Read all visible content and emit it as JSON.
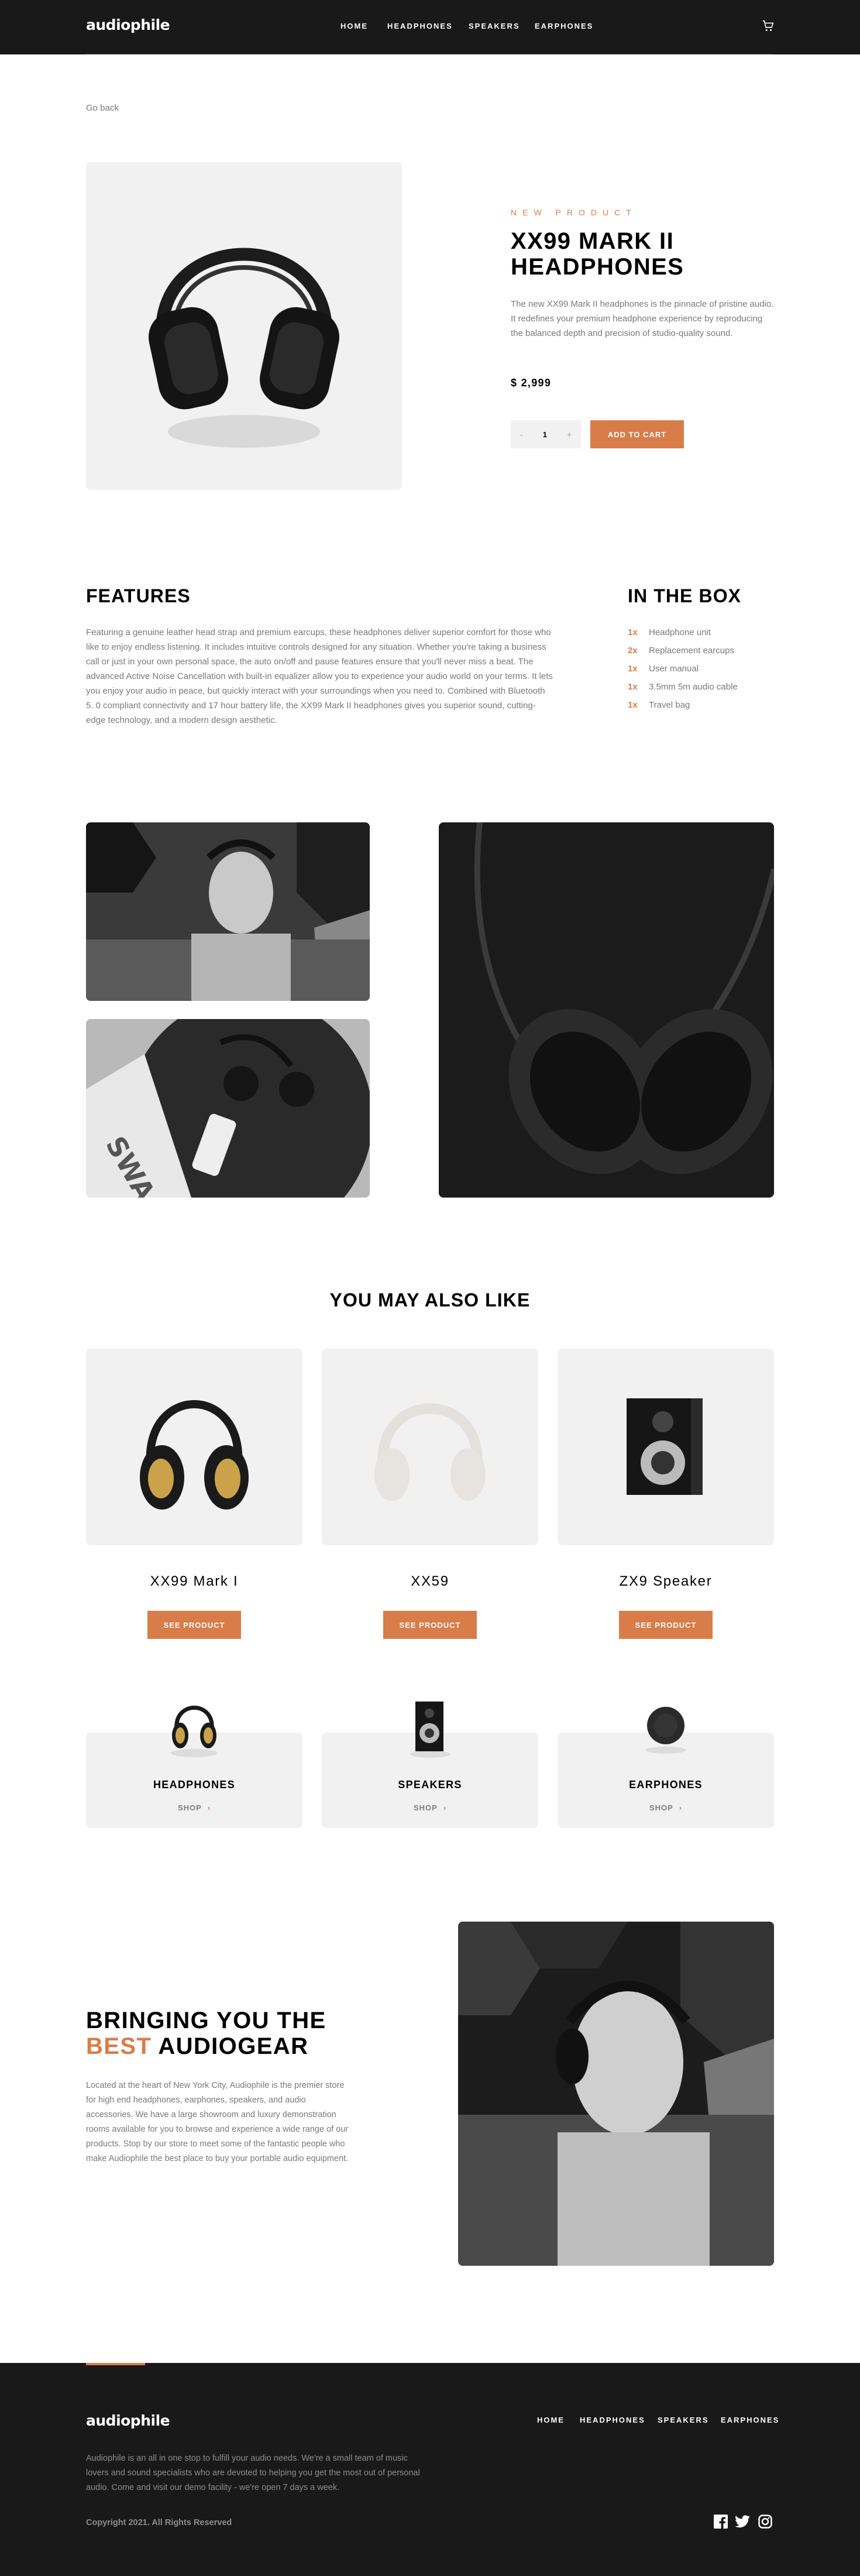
{
  "header": {
    "logo": "audiophile",
    "nav": [
      "HOME",
      "HEADPHONES",
      "SPEAKERS",
      "EARPHONES"
    ],
    "cart_icon": "cart-icon"
  },
  "go_back": "Go back",
  "product": {
    "badge": "NEW PRODUCT",
    "title_line1": "XX99 MARK II",
    "title_line2": "HEADPHONES",
    "description": "The new XX99 Mark II headphones is the pinnacle of pristine audio. It redefines your premium headphone experience by reproducing the balanced depth and precision of studio-quality sound.",
    "price": "$ 2,999",
    "quantity": {
      "minus": "-",
      "value": "1",
      "plus": "+"
    },
    "add_to_cart": "ADD TO CART"
  },
  "features": {
    "heading": "FEATURES",
    "text": "Featuring a genuine leather head strap and premium earcups, these headphones deliver superior comfort for those who like to enjoy endless listening. It includes intuitive controls designed for any situation. Whether you're taking a business call or just in your own personal space, the auto on/off and pause features ensure that you'll never miss a beat. The advanced Active Noise Cancellation with built-in equalizer allow you to experience your audio world on your terms. It lets you enjoy your audio in peace, but quickly interact with your surroundings when you need to. Combined with Bluetooth 5. 0 compliant connectivity and 17 hour battery life, the XX99 Mark II headphones gives you superior sound, cutting-edge technology, and a modern design aesthetic."
  },
  "in_the_box": {
    "heading": "IN THE BOX",
    "items": [
      {
        "qty": "1x",
        "name": "Headphone unit"
      },
      {
        "qty": "2x",
        "name": "Replacement earcups"
      },
      {
        "qty": "1x",
        "name": "User manual"
      },
      {
        "qty": "1x",
        "name": "3.5mm 5m audio cable"
      },
      {
        "qty": "1x",
        "name": "Travel bag"
      }
    ]
  },
  "also_like": {
    "heading": "YOU MAY ALSO LIKE",
    "items": [
      {
        "name": "XX99 Mark I",
        "button": "SEE PRODUCT"
      },
      {
        "name": "XX59",
        "button": "SEE PRODUCT"
      },
      {
        "name": "ZX9 Speaker",
        "button": "SEE PRODUCT"
      }
    ]
  },
  "categories": [
    {
      "name": "HEADPHONES",
      "shop": "SHOP"
    },
    {
      "name": "SPEAKERS",
      "shop": "SHOP"
    },
    {
      "name": "EARPHONES",
      "shop": "SHOP"
    }
  ],
  "about": {
    "heading_line1": "BRINGING YOU THE",
    "heading_accent": "BEST",
    "heading_rest": "AUDIOGEAR",
    "text": "Located at the heart of New York City, Audiophile is the premier store for high end headphones, earphones, speakers, and audio accessories. We have a large showroom and luxury demonstration rooms available for you to browse and experience a wide range of our products. Stop by our store to meet some of the fantastic people who make Audiophile the best place to buy your portable audio equipment."
  },
  "footer": {
    "logo": "audiophile",
    "nav": [
      "HOME",
      "HEADPHONES",
      "SPEAKERS",
      "EARPHONES"
    ],
    "text": "Audiophile is an all in one stop to fulfill your audio needs. We're a small team of music lovers and sound specialists who are devoted to helping you get the most out of personal audio. Come and visit our demo facility - we're open 7 days a week.",
    "copyright": "Copyright 2021. All Rights Reserved",
    "social": [
      "facebook-icon",
      "twitter-icon",
      "instagram-icon"
    ]
  },
  "colors": {
    "accent": "#d87d4a",
    "dark": "#191919",
    "light_gray": "#f1f1f1"
  }
}
